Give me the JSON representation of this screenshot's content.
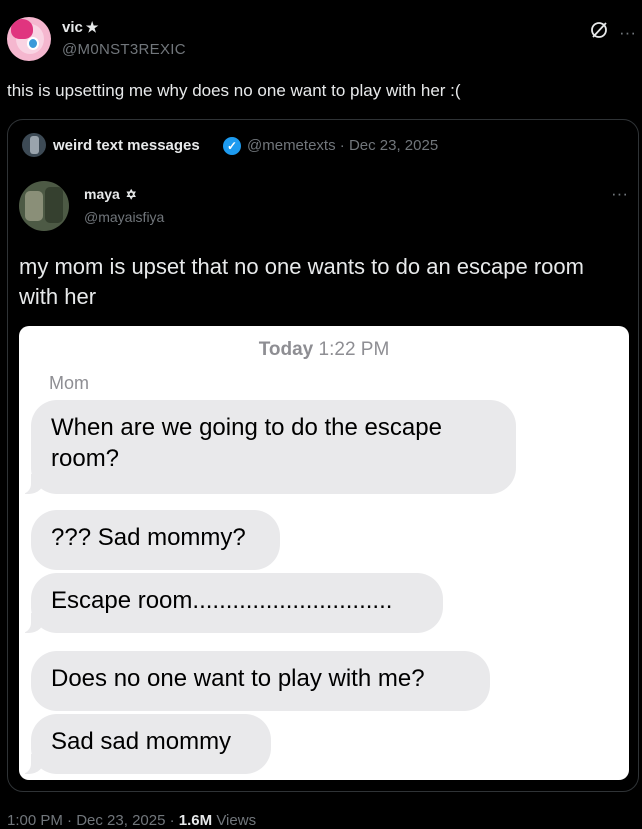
{
  "tweet": {
    "display_name": "vic",
    "name_badge": "★",
    "handle": "@M0NST3REXIC",
    "text": "this is upsetting me why does no one want to play with her :(",
    "top_icons": [
      "grok-icon",
      "more-icon"
    ],
    "more_glyph": "···",
    "footer": {
      "time": "1:00 PM",
      "date": "Dec 23, 2025",
      "views_count": "1.6M",
      "views_label": "Views"
    }
  },
  "quoted": {
    "display_name": "weird text messages",
    "verified": true,
    "handle": "@memetexts",
    "date": "Dec 23, 2025",
    "separator": "·"
  },
  "inner": {
    "display_name": "maya",
    "name_badge": "✡",
    "handle": "@mayaisfiya",
    "text": "my mom is upset that no one wants to do an escape room with her",
    "more_glyph": "···"
  },
  "screenshot": {
    "timestamp_day": "Today",
    "timestamp_time": "1:22 PM",
    "sender": "Mom",
    "messages": [
      "When are we going to do the escape room?",
      "??? Sad mommy?",
      "Escape room..............................",
      "Does no one want to play with me?",
      "Sad sad mommy"
    ],
    "bubble_color": "#e9e9eb"
  },
  "colors": {
    "background": "#000000",
    "text": "#e7e9ea",
    "muted": "#71767b",
    "verified": "#1d9bf0",
    "border": "#2f3336"
  }
}
